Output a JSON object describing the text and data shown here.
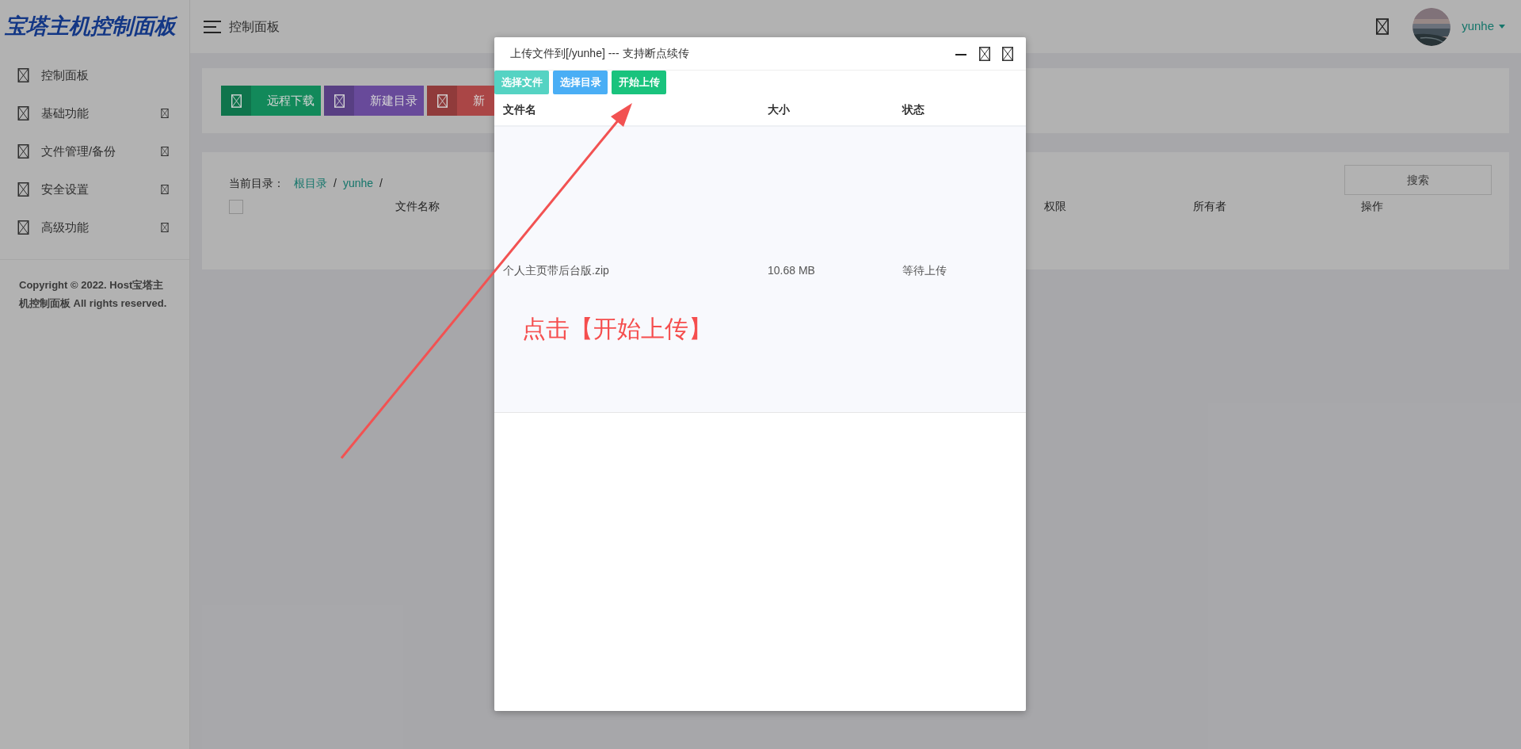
{
  "logo": "宝塔主机控制面板",
  "header": {
    "page_title": "控制面板",
    "user": "yunhe"
  },
  "sidebar": {
    "items": [
      {
        "label": "控制面板",
        "has_submenu": false
      },
      {
        "label": "基础功能",
        "has_submenu": true
      },
      {
        "label": "文件管理/备份",
        "has_submenu": true
      },
      {
        "label": "安全设置",
        "has_submenu": true
      },
      {
        "label": "高级功能",
        "has_submenu": true
      }
    ],
    "copyright": "Copyright © 2022. Host宝塔主机控制面板 All rights reserved."
  },
  "toolbar": [
    {
      "label": "远程下载",
      "color": "#12895a"
    },
    {
      "label": "新建目录",
      "color": "#684a9a"
    },
    {
      "label": "新",
      "color": "#aa4646"
    }
  ],
  "breadcrumb": {
    "label": "当前目录：",
    "path": [
      {
        "name": "根目录",
        "separator": "/"
      },
      {
        "name": "yunhe",
        "separator": "/"
      }
    ]
  },
  "search_button": "搜索",
  "file_table": {
    "select_all": {
      "checked": false
    },
    "columns": [
      "文件名称",
      "权限",
      "所有者",
      "操作"
    ]
  },
  "upload_dialog": {
    "title": "上传文件到[/yunhe] --- 支持断点续传",
    "buttons": [
      {
        "label": "选择文件",
        "color": "#55d3c3"
      },
      {
        "label": "选择目录",
        "color": "#4aaef5"
      },
      {
        "label": "开始上传",
        "color": "#19c37d"
      }
    ],
    "columns": [
      "文件名",
      "大小",
      "状态"
    ],
    "files": [
      {
        "name": "个人主页带后台版.zip",
        "size": "10.68 MB",
        "status": "等待上传"
      }
    ]
  },
  "annotation": "点击【开始上传】"
}
